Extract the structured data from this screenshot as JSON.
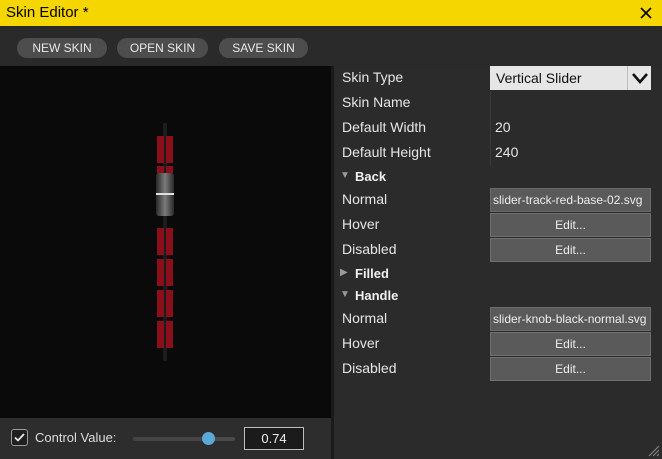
{
  "window": {
    "title": "Skin Editor *"
  },
  "toolbar": {
    "new_label": "NEW SKIN",
    "open_label": "OPEN SKIN",
    "save_label": "SAVE SKIN"
  },
  "bottom": {
    "checkbox_checked": true,
    "control_label": "Control Value:",
    "control_value": "0.74",
    "slider_value": 0.74
  },
  "properties": {
    "skin_type": {
      "label": "Skin Type",
      "value": "Vertical Slider"
    },
    "skin_name": {
      "label": "Skin Name",
      "value": ""
    },
    "default_width": {
      "label": "Default Width",
      "value": "20"
    },
    "default_height": {
      "label": "Default Height",
      "value": "240"
    }
  },
  "sections": {
    "back": {
      "title": "Back",
      "normal": {
        "label": "Normal",
        "value": "slider-track-red-base-02.svg"
      },
      "hover": {
        "label": "Hover",
        "button": "Edit..."
      },
      "disabled": {
        "label": "Disabled",
        "button": "Edit..."
      }
    },
    "filled": {
      "title": "Filled"
    },
    "handle": {
      "title": "Handle",
      "normal": {
        "label": "Normal",
        "value": "slider-knob-black-normal.svg"
      },
      "hover": {
        "label": "Hover",
        "button": "Edit..."
      },
      "disabled": {
        "label": "Disabled",
        "button": "Edit..."
      }
    }
  },
  "colors": {
    "titlebar": "#f5d600",
    "accent": "#5aa9d8",
    "track_red": "#8a0f1a"
  }
}
